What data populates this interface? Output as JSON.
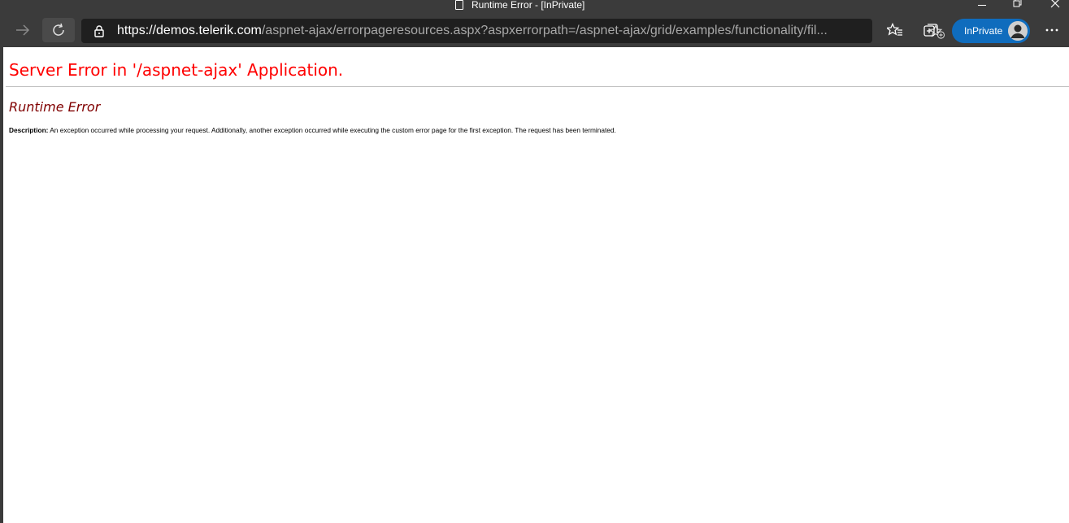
{
  "window": {
    "title": "Runtime Error - [InPrivate]"
  },
  "toolbar": {
    "url_protocol": "https://",
    "url_host": "demos.telerik.com",
    "url_path": "/aspnet-ajax/errorpageresources.aspx?aspxerrorpath=/aspnet-ajax/grid/examples/functionality/fil...",
    "inprivate_label": "InPrivate",
    "accent_color": "#0f6cbd"
  },
  "icons": {
    "forward": "forward-arrow-icon",
    "refresh": "refresh-icon",
    "lock": "lock-icon",
    "add_favorite": "star-plus-icon",
    "favorites": "favorites-star-icon",
    "collections": "collections-icon",
    "more": "more-horizontal-icon"
  },
  "page": {
    "heading": "Server Error in '/aspnet-ajax' Application.",
    "subheading": "Runtime Error",
    "description_label": "Description:",
    "description_text": " An exception occurred while processing your request. Additionally, another exception occurred while executing the custom error page for the first exception. The request has been terminated.",
    "heading_color": "#ff0000",
    "subheading_color": "#800000"
  }
}
